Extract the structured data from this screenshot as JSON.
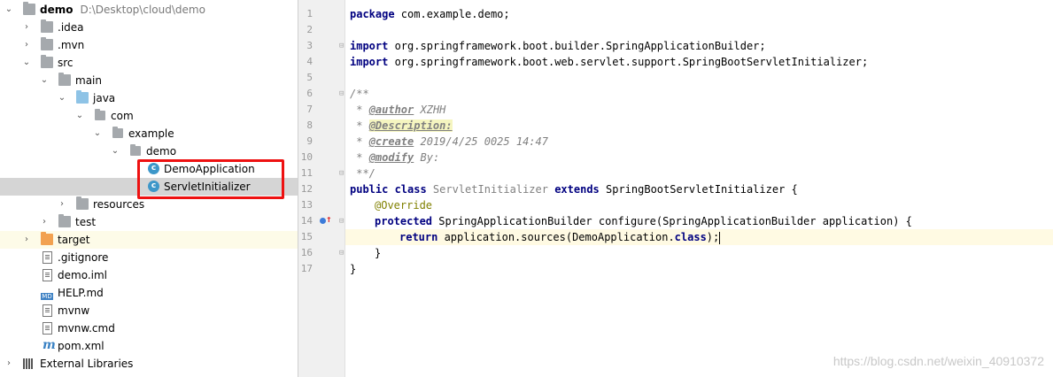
{
  "project_tree": {
    "root": {
      "name": "demo",
      "path": "D:\\Desktop\\cloud\\demo"
    },
    "items": [
      {
        "label": ".idea"
      },
      {
        "label": ".mvn"
      },
      {
        "label": "src"
      },
      {
        "label": "main"
      },
      {
        "label": "java"
      },
      {
        "label": "com"
      },
      {
        "label": "example"
      },
      {
        "label": "demo"
      },
      {
        "label": "DemoApplication"
      },
      {
        "label": "ServletInitializer"
      },
      {
        "label": "resources"
      },
      {
        "label": "test"
      },
      {
        "label": "target"
      },
      {
        "label": ".gitignore"
      },
      {
        "label": "demo.iml"
      },
      {
        "label": "HELP.md"
      },
      {
        "label": "mvnw"
      },
      {
        "label": "mvnw.cmd"
      },
      {
        "label": "pom.xml"
      },
      {
        "label": "External Libraries"
      }
    ],
    "class_icon_letter": "c",
    "md_icon_text": "MD",
    "maven_icon_text": "m"
  },
  "editor": {
    "line_numbers": [
      "1",
      "2",
      "3",
      "4",
      "5",
      "6",
      "7",
      "8",
      "9",
      "10",
      "11",
      "12",
      "13",
      "14",
      "15",
      "16",
      "17"
    ],
    "code": {
      "l1_kw": "package",
      "l1_rest": " com.example.demo;",
      "l3_kw": "import",
      "l3_rest": " org.springframework.boot.builder.SpringApplicationBuilder;",
      "l4_kw": "import",
      "l4_rest": " org.springframework.boot.web.servlet.support.SpringBootServletInitializer;",
      "l6": "/**",
      "l7_pre": " * ",
      "l7_tag": "@author",
      "l7_rest": " XZHH",
      "l8_pre": " * ",
      "l8_tag": "@Description:",
      "l9_pre": " * ",
      "l9_tag": "@create",
      "l9_rest": " 2019/4/25 0025 14:47",
      "l10_pre": " * ",
      "l10_tag": "@modify",
      "l10_rest": " By:",
      "l11": " **/",
      "l12_kw1": "public class",
      "l12_name": " ServletInitializer ",
      "l12_kw2": "extends",
      "l12_rest": " SpringBootServletInitializer {",
      "l13": "@Override",
      "l14_kw": "protected",
      "l14_rest": " SpringApplicationBuilder configure(SpringApplicationBuilder application) {",
      "l15_kw": "return",
      "l15_rest1": " application.sources(DemoApplication.",
      "l15_kw2": "class",
      "l15_rest2": ");",
      "l16": "}",
      "l17": "}"
    }
  },
  "watermark": "https://blog.csdn.net/weixin_40910372",
  "colors": {
    "highlight_box": "#ee1111",
    "keyword": "#000080",
    "annotation": "#808000",
    "current_line": "#fffae3"
  }
}
